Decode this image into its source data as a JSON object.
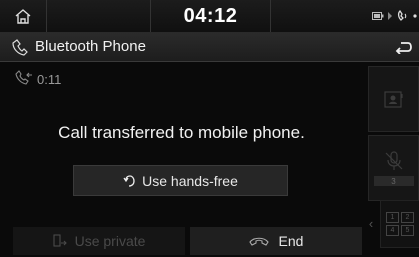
{
  "status_bar": {
    "time": "04:12"
  },
  "header": {
    "title": "Bluetooth Phone"
  },
  "call": {
    "timer": "0:11",
    "message": "Call transferred to mobile phone."
  },
  "buttons": {
    "hands_free": "Use hands-free",
    "private": "Use private",
    "end": "End"
  },
  "side_panel": {
    "mic_level": "3",
    "keypad_keys": [
      "1",
      "2",
      "4",
      "5"
    ]
  },
  "colors": {
    "background": "#0a0a0a",
    "text": "#e8e8e8",
    "disabled": "#4a4a4a"
  }
}
